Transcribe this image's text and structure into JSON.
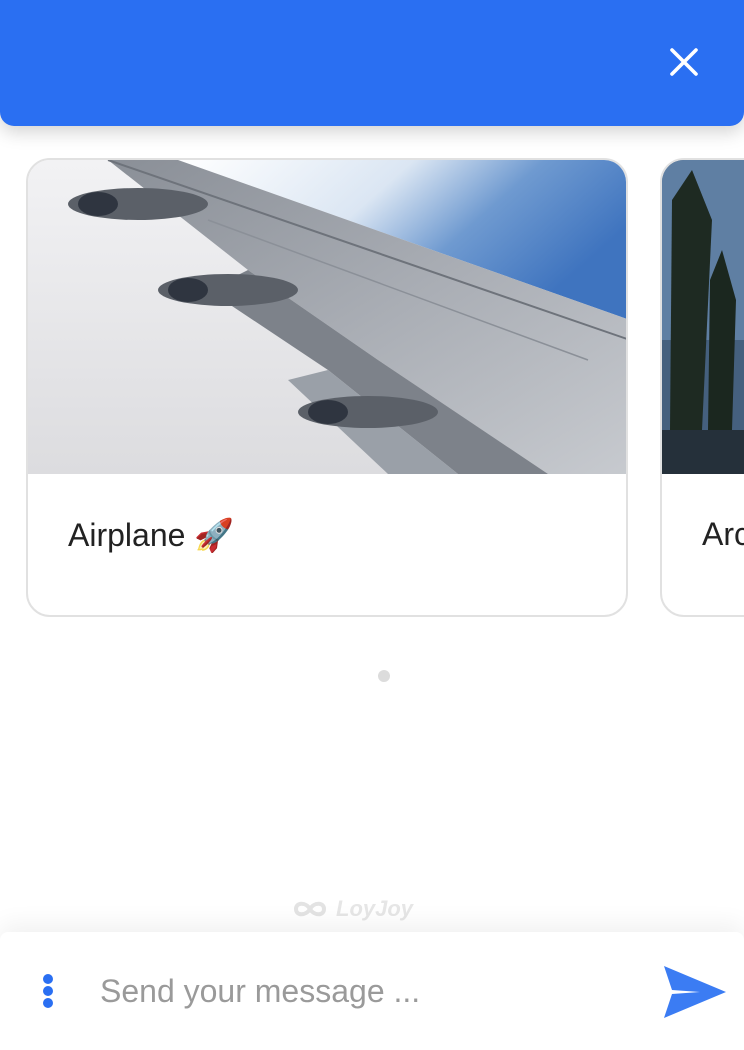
{
  "colors": {
    "header": "#2a6ff2",
    "accent": "#2a6ff2",
    "send": "#3b7cf3",
    "card_border": "#e1e1e1",
    "dot_inactive": "#dcdcdc"
  },
  "header": {
    "close_icon": "close-icon"
  },
  "carousel": {
    "cards": [
      {
        "title": "Airplane 🚀",
        "image": "airplane-wing-photo"
      },
      {
        "title": "Arc",
        "image": "cypress-trees-photo"
      }
    ],
    "page_count": 1,
    "active_page": 1
  },
  "brand": {
    "name": "LoyJoy",
    "icon": "infinity-logo"
  },
  "composer": {
    "placeholder": "Send your message ...",
    "value": "",
    "menu_icon": "more-vertical-icon",
    "send_icon": "send-icon"
  }
}
